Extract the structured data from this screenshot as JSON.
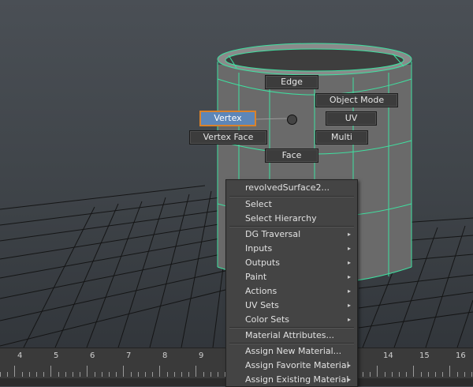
{
  "hotbox": {
    "north": "Edge",
    "east": "Object Mode",
    "west": "Vertex",
    "east_south": "UV",
    "west_south": "Vertex Face",
    "east_south2": "Multi",
    "south": "Face"
  },
  "ruler": {
    "ticks": [
      "4",
      "5",
      "6",
      "7",
      "8",
      "9",
      "14",
      "15",
      "16"
    ]
  },
  "menu": {
    "title": "revolvedSurface2...",
    "items": [
      {
        "label": "Select",
        "submenu": false
      },
      {
        "label": "Select Hierarchy",
        "submenu": false
      },
      {
        "label": "DG Traversal",
        "submenu": true
      },
      {
        "label": "Inputs",
        "submenu": true
      },
      {
        "label": "Outputs",
        "submenu": true
      },
      {
        "label": "Paint",
        "submenu": true
      },
      {
        "label": "Actions",
        "submenu": true
      },
      {
        "label": "UV Sets",
        "submenu": true
      },
      {
        "label": "Color Sets",
        "submenu": true
      },
      {
        "label": "Material Attributes...",
        "submenu": false
      },
      {
        "label": "Assign New Material...",
        "submenu": false
      },
      {
        "label": "Assign Favorite Material",
        "submenu": true
      },
      {
        "label": "Assign Existing Material",
        "submenu": true
      }
    ]
  },
  "colors": {
    "wireframe": "#3fe0a0",
    "selection_outline": "#d9822b",
    "selected_fill": "#5d86b8"
  },
  "icons": {
    "arrow": "submenu-arrow-icon"
  }
}
